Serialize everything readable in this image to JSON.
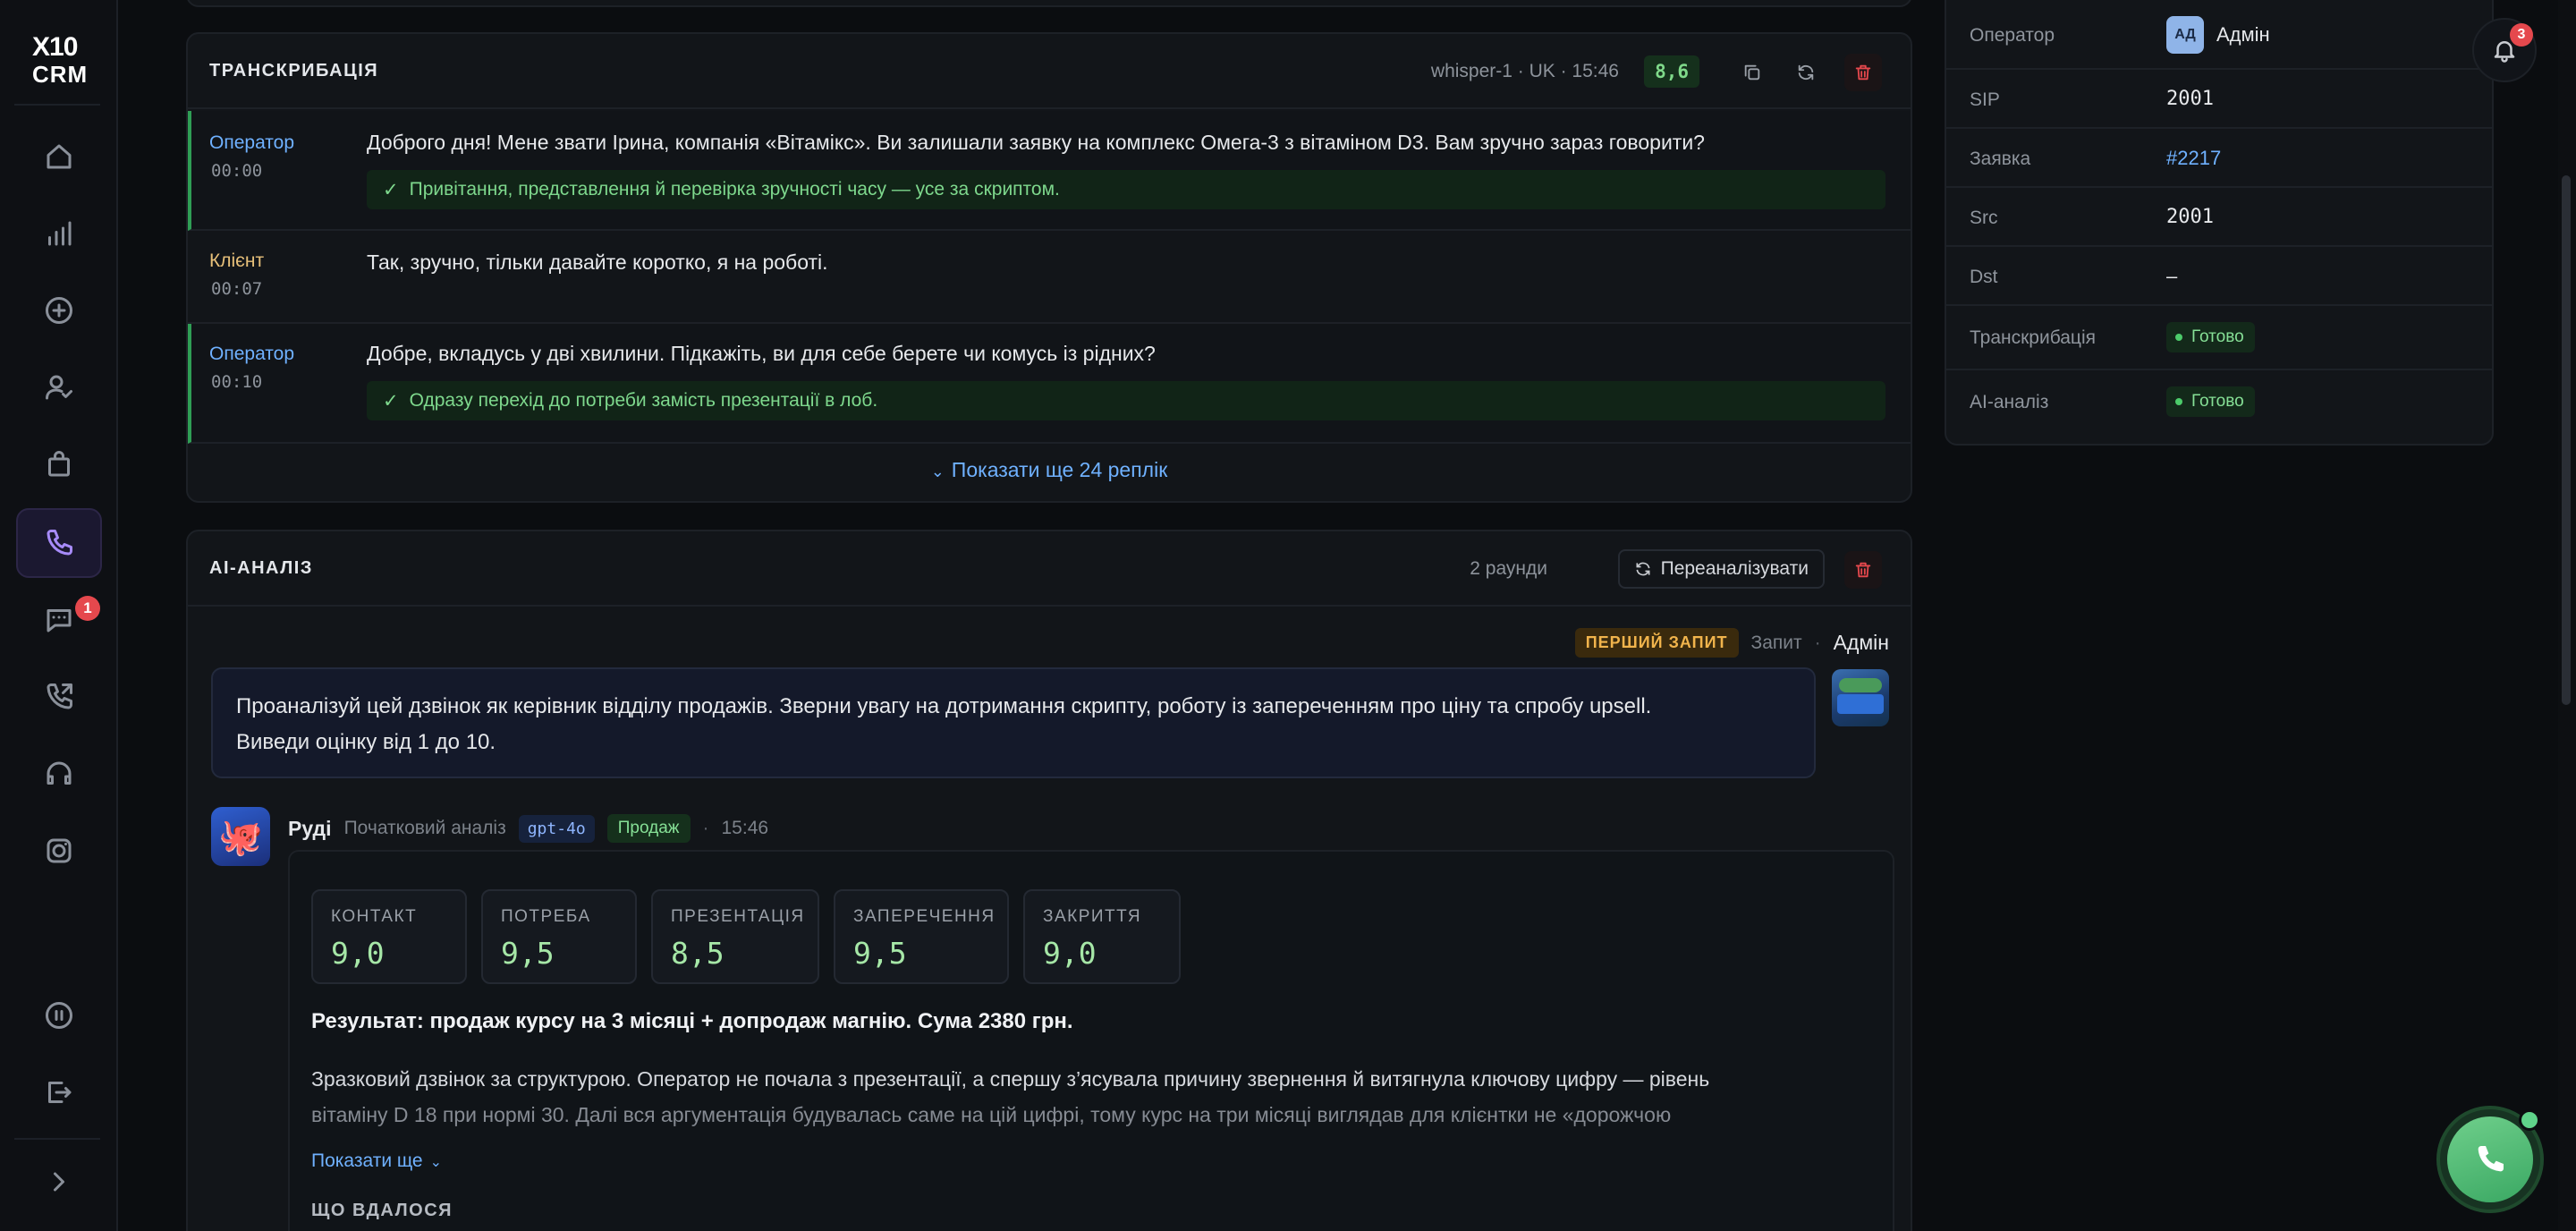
{
  "brand": {
    "line1": "X10",
    "line2": "CRM"
  },
  "sidebar": {
    "nav": [
      {
        "icon": "home-icon"
      },
      {
        "icon": "chart-icon"
      },
      {
        "icon": "plus-circle-icon"
      },
      {
        "icon": "user-check-icon"
      },
      {
        "icon": "bag-icon"
      },
      {
        "icon": "phone-icon",
        "active": true
      },
      {
        "icon": "chat-icon",
        "badge": "1"
      },
      {
        "icon": "phone-forward-icon"
      },
      {
        "icon": "headset-icon"
      },
      {
        "icon": "instagram-icon"
      }
    ],
    "bottom": [
      {
        "icon": "pause-icon"
      },
      {
        "icon": "logout-icon"
      },
      {
        "icon": "chevron-right-icon"
      }
    ]
  },
  "transcription": {
    "title": "ТРАНСКРИБАЦІЯ",
    "meta": "whisper-1 · UK · 15:46",
    "score": "8,6",
    "rows": [
      {
        "speaker": "Оператор",
        "time": "00:00",
        "text": "Доброго дня! Мене звати Ірина, компанія «Вітамікс». Ви залишали заявку на комплекс Омега-3 з вітаміном D3. Вам зручно зараз говорити?",
        "note": "Привітання, представлення й перевірка зручності часу — усе за скриптом."
      },
      {
        "speaker": "Клієнт",
        "time": "00:07",
        "text": "Так, зручно, тільки давайте коротко, я на роботі."
      },
      {
        "speaker": "Оператор",
        "time": "00:10",
        "text": "Добре, вкладусь у дві хвилини. Підкажіть, ви для себе берете чи комусь із рідних?",
        "note": "Одразу перехід до потреби замість презентації в лоб."
      }
    ],
    "show_more": "Показати ще 24 реплік"
  },
  "info": {
    "rows": [
      {
        "key": "Оператор",
        "value": "Адмін",
        "avatar": "АД"
      },
      {
        "key": "SIP",
        "value": "2001",
        "mono": true
      },
      {
        "key": "Заявка",
        "value": "#2217",
        "link": true
      },
      {
        "key": "Src",
        "value": "2001",
        "mono": true
      },
      {
        "key": "Dst",
        "value": "–"
      },
      {
        "key": "Транскрибація",
        "status": "Готово"
      },
      {
        "key": "AI-аналіз",
        "status": "Готово"
      }
    ]
  },
  "notifications": {
    "count": "3"
  },
  "analysis": {
    "title": "AI-АНАЛІЗ",
    "rounds": "2 раунди",
    "reanalyze": "Переаналізувати",
    "request": {
      "tag": "ПЕРШИЙ ЗАПИТ",
      "label": "Запит",
      "author": "Адмін",
      "line1": "Проаналізуй цей дзвінок як керівник відділу продажів. Зверни увагу на дотримання скрипту, роботу із запереченням про ціну та спробу upsell.",
      "line2": "Виведи оцінку від 1 до 10."
    },
    "reply": {
      "author": "Руді",
      "kind": "Початковий аналіз",
      "model": "gpt-4o",
      "tag": "Продаж",
      "time": "15:46",
      "metrics": [
        {
          "label": "КОНТАКТ",
          "value": "9,0"
        },
        {
          "label": "ПОТРЕБА",
          "value": "9,5"
        },
        {
          "label": "ПРЕЗЕНТАЦІЯ",
          "value": "8,5"
        },
        {
          "label": "ЗАПЕРЕЧЕННЯ",
          "value": "9,5"
        },
        {
          "label": "ЗАКРИТТЯ",
          "value": "9,0"
        }
      ],
      "result": "Результат: продаж курсу на 3 місяці + допродаж магнію. Сума 2380 грн.",
      "body1": "Зразковий дзвінок за структурою. Оператор не почала з презентації, а спершу з’ясувала причину звернення й витягнула ключову цифру — рівень",
      "body2": "вітаміну D 18 при нормі 30. Далі вся аргументація будувалась саме на цій цифрі, тому курс на три місяці виглядав для клієнтки не «дорожчою",
      "show_more": "Показати ще",
      "section": "ЩО ВДАЛОСЯ"
    }
  },
  "colors": {
    "accent": "#a78bfa",
    "ok": "#7fd98a",
    "link": "#6fb1ff",
    "danger": "#e5484d"
  }
}
